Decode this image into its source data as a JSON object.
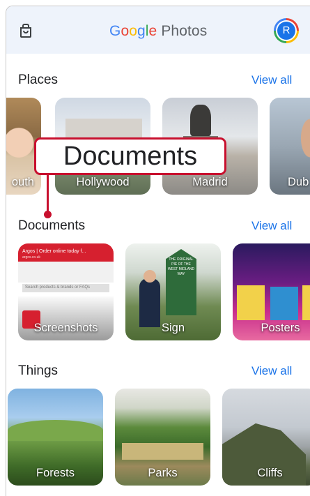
{
  "header": {
    "logo_g": [
      "G",
      "o",
      "o",
      "g",
      "l",
      "e"
    ],
    "logo_colors": [
      "#4285f4",
      "#ea4335",
      "#fbbc05",
      "#4285f4",
      "#34a853",
      "#ea4335"
    ],
    "photos": "Photos",
    "avatar_letter": "R"
  },
  "places": {
    "title": "Places",
    "view_all": "View all",
    "items": [
      {
        "label": "outh"
      },
      {
        "label": "Hollywood"
      },
      {
        "label": "Madrid"
      },
      {
        "label": "Dub"
      }
    ]
  },
  "documents": {
    "title": "Documents",
    "view_all": "View all",
    "items": [
      {
        "label": "Screenshots"
      },
      {
        "label": "Sign"
      },
      {
        "label": "Posters"
      }
    ]
  },
  "things": {
    "title": "Things",
    "view_all": "View all",
    "items": [
      {
        "label": "Forests"
      },
      {
        "label": "Parks"
      },
      {
        "label": "Cliffs"
      }
    ]
  },
  "callout": {
    "label": "Documents",
    "color": "#c8102e"
  },
  "screenshot_thumb": {
    "header": "Argos | Order online today f...",
    "sub": "argos.co.uk",
    "search": "Search products & brands or FAQs"
  },
  "sign_thumb": {
    "text": "THE ORIGINAL PIE OF THE WEST MIDLAND WAY"
  }
}
